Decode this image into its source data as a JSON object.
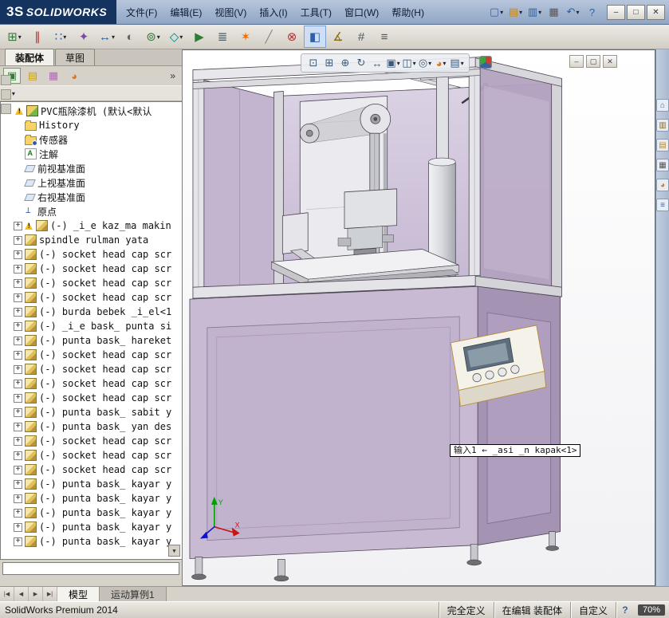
{
  "colors": {
    "titlebar-top": "#b7c6dc",
    "titlebar-bottom": "#8fa6c4",
    "logo-bg": "#14335f",
    "machine-panel": "#c8bad3",
    "machine-panel-dark": "#a593b4",
    "console": "#f5f2e9",
    "screen": "#5e6e7c"
  },
  "titlebar": {
    "logo_mark": "3S",
    "logo_text": "SOLIDWORKS",
    "menus": [
      {
        "label": "文件(F)"
      },
      {
        "label": "编辑(E)"
      },
      {
        "label": "视图(V)"
      },
      {
        "label": "插入(I)"
      },
      {
        "label": "工具(T)"
      },
      {
        "label": "窗口(W)"
      },
      {
        "label": "帮助(H)"
      }
    ],
    "quick_icons": [
      {
        "name": "new-document-button",
        "glyph": "▢",
        "color": "#3a61a0",
        "cls": "has-caret"
      },
      {
        "name": "open-button",
        "glyph": "▤",
        "color": "#c8861a",
        "cls": "has-caret"
      },
      {
        "name": "save-button",
        "glyph": "▥",
        "color": "#2f5fa8",
        "cls": "has-caret"
      },
      {
        "name": "print-button",
        "glyph": "▦",
        "color": "#555555"
      },
      {
        "name": "undo-button",
        "glyph": "↶",
        "color": "#2f5fa8",
        "cls": "has-caret"
      },
      {
        "name": "help-button",
        "glyph": "?",
        "color": "#2f5fa8"
      }
    ],
    "controls": [
      {
        "name": "minimize-button",
        "glyph": "–"
      },
      {
        "name": "maximize-button",
        "glyph": "□"
      },
      {
        "name": "close-button",
        "glyph": "✕"
      }
    ]
  },
  "toolbar": {
    "icons": [
      {
        "name": "insert-components-button",
        "glyph": "⊞",
        "color": "#2f7d32",
        "cls": "has-caret"
      },
      {
        "name": "mate-button",
        "glyph": "∥",
        "color": "#b03030"
      },
      {
        "name": "linear-component-pattern-button",
        "glyph": "∷",
        "color": "#2f5fa8",
        "cls": "has-caret"
      },
      {
        "name": "smart-fasteners-button",
        "glyph": "✦",
        "color": "#7a4aa8"
      },
      {
        "name": "move-component-button",
        "glyph": "↔",
        "color": "#2f5fa8",
        "cls": "has-caret"
      },
      {
        "name": "show-hidden-components-button",
        "glyph": "◐",
        "color": "#666666"
      },
      {
        "name": "assembly-features-button",
        "glyph": "⊚",
        "color": "#2f7d32",
        "cls": "has-caret"
      },
      {
        "name": "reference-geometry-button",
        "glyph": "◇",
        "color": "#00838f",
        "cls": "has-caret"
      },
      {
        "name": "new-motion-study-button",
        "glyph": "▶",
        "color": "#2f7d32"
      },
      {
        "name": "bill-of-materials-button",
        "glyph": "≣",
        "color": "#455a64"
      },
      {
        "name": "exploded-view-button",
        "glyph": "✶",
        "color": "#ef6c00"
      },
      {
        "name": "explode-line-sketch-button",
        "glyph": "╱",
        "color": "#888888"
      },
      {
        "name": "interference-detection-button",
        "glyph": "⊗",
        "color": "#b03030"
      },
      {
        "name": "section-view-button",
        "glyph": "◧",
        "color": "#2f5fa8",
        "cls": "pressed"
      },
      {
        "name": "measure-button",
        "glyph": "∡",
        "color": "#8a6d1a"
      },
      {
        "name": "mass-properties-button",
        "glyph": "#",
        "color": "#455a64"
      },
      {
        "name": "options-button",
        "glyph": "≡",
        "color": "#555555"
      }
    ]
  },
  "panel": {
    "tabs": [
      {
        "label": "装配体",
        "cls": "active"
      },
      {
        "label": "草图",
        "cls": ""
      }
    ],
    "fm_icons": [
      {
        "name": "featuremanager-tab-icon",
        "glyph": "▣",
        "color": "#2f7d32",
        "cls": "pressed"
      },
      {
        "name": "propertymanager-tab-icon",
        "glyph": "▤",
        "color": "#c8a21a",
        "cls": ""
      },
      {
        "name": "configurationmanager-tab-icon",
        "glyph": "▦",
        "color": "#b06ab0",
        "cls": ""
      },
      {
        "name": "displaymanager-tab-icon",
        "glyph": "◕",
        "color": "#d07a2a",
        "cls": ""
      }
    ],
    "overflow_label": "»",
    "filter_icon": "▼",
    "tree": [
      {
        "cls": "lvl0 icon-assembly warn",
        "label": "PVC瓶除漆机 (默认<默认"
      },
      {
        "cls": "lvl1 icon-history",
        "label": "History"
      },
      {
        "cls": "lvl1 icon-sensors",
        "label": "传感器"
      },
      {
        "cls": "lvl1 icon-annotations",
        "label": "注解"
      },
      {
        "cls": "lvl1 icon-plane",
        "label": "前视基准面"
      },
      {
        "cls": "lvl1 icon-plane",
        "label": "上视基准面"
      },
      {
        "cls": "lvl1 icon-plane",
        "label": "右视基准面"
      },
      {
        "cls": "lvl1 icon-origin",
        "label": "原点"
      },
      {
        "cls": "lvl1 can-expand icon-part warn",
        "label": "(-) _i_e kaz_ma makin"
      },
      {
        "cls": "lvl1 can-expand icon-part",
        "label": "spindle rulman yata"
      },
      {
        "cls": "lvl1 can-expand icon-part",
        "label": "(-) socket head cap scr"
      },
      {
        "cls": "lvl1 can-expand icon-part",
        "label": "(-) socket head cap scr"
      },
      {
        "cls": "lvl1 can-expand icon-part",
        "label": "(-) socket head cap scr"
      },
      {
        "cls": "lvl1 can-expand icon-part",
        "label": "(-) socket head cap scr"
      },
      {
        "cls": "lvl1 can-expand icon-part",
        "label": "(-) burda bebek _i_el<1"
      },
      {
        "cls": "lvl1 can-expand icon-part",
        "label": "(-) _i_e bask_ punta si"
      },
      {
        "cls": "lvl1 can-expand icon-part",
        "label": "(-) punta bask_ hareket"
      },
      {
        "cls": "lvl1 can-expand icon-part",
        "label": "(-) socket head cap scr"
      },
      {
        "cls": "lvl1 can-expand icon-part",
        "label": "(-) socket head cap scr"
      },
      {
        "cls": "lvl1 can-expand icon-part",
        "label": "(-) socket head cap scr"
      },
      {
        "cls": "lvl1 can-expand icon-part",
        "label": "(-) socket head cap scr"
      },
      {
        "cls": "lvl1 can-expand icon-part",
        "label": "(-) punta bask_ sabit y"
      },
      {
        "cls": "lvl1 can-expand icon-part",
        "label": "(-) punta bask_ yan des"
      },
      {
        "cls": "lvl1 can-expand icon-part",
        "label": "(-) socket head cap scr"
      },
      {
        "cls": "lvl1 can-expand icon-part",
        "label": "(-) socket head cap scr"
      },
      {
        "cls": "lvl1 can-expand icon-part",
        "label": "(-) socket head cap scr"
      },
      {
        "cls": "lvl1 can-expand icon-part",
        "label": "(-) punta bask_ kayar y"
      },
      {
        "cls": "lvl1 can-expand icon-part",
        "label": "(-) punta bask_ kayar y"
      },
      {
        "cls": "lvl1 can-expand icon-part",
        "label": "(-) punta bask_ kayar y"
      },
      {
        "cls": "lvl1 can-expand icon-part",
        "label": "(-) punta bask_ kayar y"
      },
      {
        "cls": "lvl1 can-expand icon-part",
        "label": "(-) punta bask_ kayar y"
      }
    ]
  },
  "viewport": {
    "annotation": "输入1 ← _asi _n kapak<1>",
    "triad": {
      "y_label": "Y",
      "x_label": "X"
    },
    "view_toolbar": [
      {
        "name": "zoom-to-fit-button",
        "glyph": "⊡",
        "cls": ""
      },
      {
        "name": "zoom-to-area-button",
        "glyph": "⊞",
        "cls": ""
      },
      {
        "name": "zoom-in-out-button",
        "glyph": "⊕",
        "cls": ""
      },
      {
        "name": "rotate-view-button",
        "glyph": "↻",
        "cls": ""
      },
      {
        "name": "pan-button",
        "glyph": "↔",
        "cls": ""
      },
      {
        "name": "view-orientation-button",
        "glyph": "▣",
        "cls": "has-caret"
      },
      {
        "name": "display-style-button",
        "glyph": "◫",
        "cls": "has-caret"
      },
      {
        "name": "hide-show-items-button",
        "glyph": "◎",
        "cls": "has-caret"
      },
      {
        "name": "edit-appearance-button",
        "glyph": "◕",
        "color": "#d07a2a",
        "cls": "has-caret"
      },
      {
        "name": "apply-scene-button",
        "glyph": "▤",
        "cls": "has-caret"
      }
    ],
    "window_buttons": [
      {
        "name": "viewport-minimize-button",
        "glyph": "–"
      },
      {
        "name": "viewport-restore-button",
        "glyph": "▢"
      },
      {
        "name": "viewport-close-button",
        "glyph": "✕"
      }
    ]
  },
  "taskpane": {
    "icons": [
      {
        "name": "solidworks-resources-icon",
        "glyph": "⌂",
        "color": "#3a61a0"
      },
      {
        "name": "design-library-icon",
        "glyph": "▥",
        "color": "#8a6d1a"
      },
      {
        "name": "file-explorer-icon",
        "glyph": "▤",
        "color": "#c8861a"
      },
      {
        "name": "view-palette-icon",
        "glyph": "▦",
        "color": "#555555"
      },
      {
        "name": "appearances-icon",
        "glyph": "◕",
        "color": "#d07a2a"
      },
      {
        "name": "custom-properties-icon",
        "glyph": "≡",
        "color": "#3a61a0"
      }
    ]
  },
  "tabbar": {
    "nav": [
      {
        "name": "first-tab-button",
        "glyph": "|◀"
      },
      {
        "name": "prev-tab-button",
        "glyph": "◀"
      },
      {
        "name": "next-tab-button",
        "glyph": "▶"
      },
      {
        "name": "last-tab-button",
        "glyph": "▶|"
      }
    ],
    "tabs": [
      {
        "label": "模型",
        "cls": "active"
      },
      {
        "label": "运动算例1",
        "cls": ""
      }
    ]
  },
  "statusbar": {
    "app": "SolidWorks Premium 2014",
    "segments": [
      {
        "label": "完全定义"
      },
      {
        "label": "在编辑 装配体"
      },
      {
        "label": "自定义"
      }
    ],
    "help": "?",
    "zoom": "70%"
  }
}
